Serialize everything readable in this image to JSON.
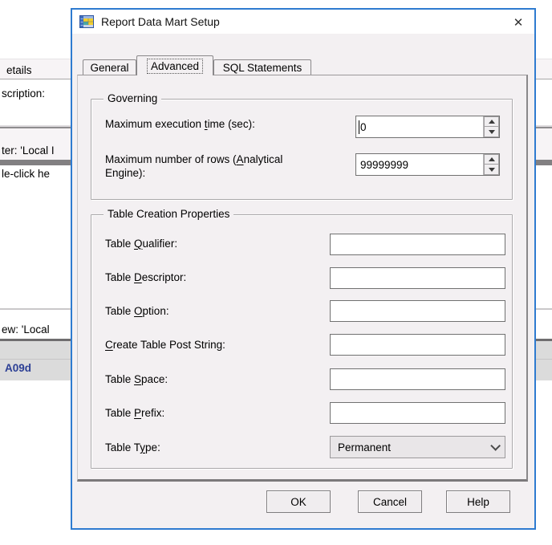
{
  "window": {
    "title": "Report Data Mart Setup",
    "close_glyph": "✕"
  },
  "tabs": {
    "general": "General",
    "advanced": "Advanced",
    "sql": "SQL Statements"
  },
  "governing": {
    "title": "Governing",
    "max_time": {
      "prefix": "Maximum execution ",
      "accel": "t",
      "suffix": "ime (sec):",
      "value": "0"
    },
    "max_rows": {
      "prefix": "Maximum number of rows (",
      "accel": "A",
      "suffix": "nalytical Engine):",
      "value": "99999999"
    }
  },
  "table_props": {
    "title": "Table Creation Properties",
    "qualifier": {
      "prefix": "Table ",
      "accel": "Q",
      "suffix": "ualifier:",
      "value": ""
    },
    "descriptor": {
      "prefix": "Table ",
      "accel": "D",
      "suffix": "escriptor:",
      "value": ""
    },
    "option": {
      "prefix": "Table ",
      "accel": "O",
      "suffix": "ption:",
      "value": ""
    },
    "post_string": {
      "prefix": "",
      "accel": "C",
      "suffix": "reate Table Post String:",
      "value": ""
    },
    "space": {
      "prefix": "Table ",
      "accel": "S",
      "suffix": "pace:",
      "value": ""
    },
    "prefix_field": {
      "prefix": "Table ",
      "accel": "P",
      "suffix": "refix:",
      "value": ""
    },
    "type": {
      "prefix": "Table T",
      "accel": "y",
      "suffix": "pe:",
      "value": "Permanent"
    }
  },
  "buttons": {
    "ok": "OK",
    "cancel": "Cancel",
    "help": "Help"
  },
  "background": {
    "details": "etails",
    "description": "scription:",
    "filter": "ter: 'Local I",
    "double_click": "le-click he",
    "view": "ew: 'Local",
    "record_id": "A09d"
  },
  "colors": {
    "dialog_border": "#2e7bd0",
    "dialog_face": "#f3f0f2",
    "record_id_blue": "#2c3f95",
    "dark_bar": "#828082"
  }
}
